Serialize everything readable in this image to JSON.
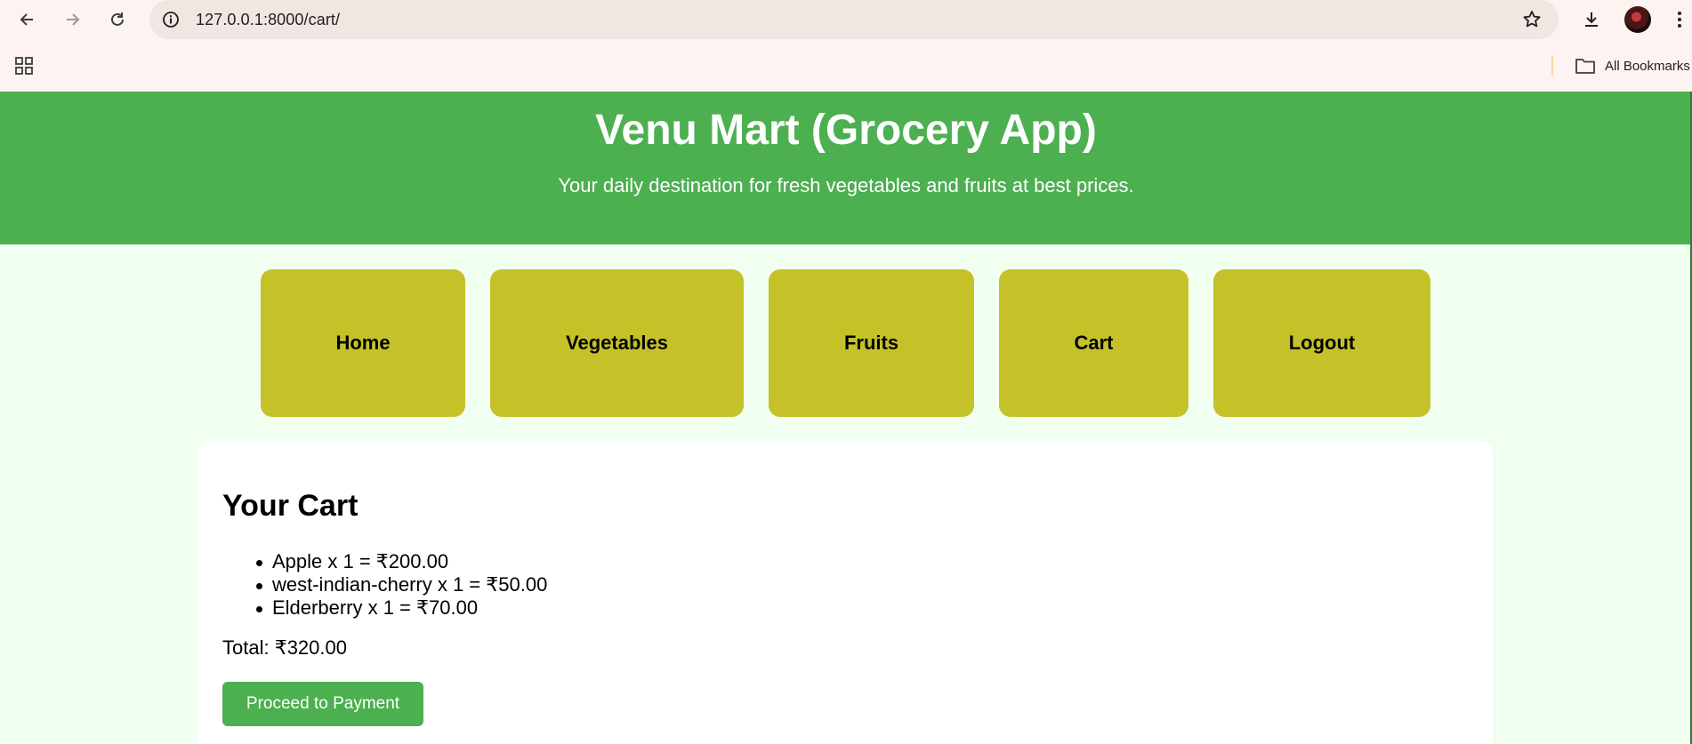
{
  "browser": {
    "url": "127.0.0.1:8000/cart/",
    "bookmarks_label": "All Bookmarks"
  },
  "header": {
    "title": "Venu Mart (Grocery App)",
    "subtitle": "Your daily destination for fresh vegetables and fruits at best prices.",
    "background": "#4caf50"
  },
  "nav": {
    "items": [
      {
        "label": "Home"
      },
      {
        "label": "Vegetables"
      },
      {
        "label": "Fruits"
      },
      {
        "label": "Cart"
      },
      {
        "label": "Logout"
      }
    ],
    "button_color": "#c5c229"
  },
  "cart": {
    "heading": "Your Cart",
    "items": [
      {
        "text": "Apple x 1 = ₹200.00"
      },
      {
        "text": "west-indian-cherry x 1 = ₹50.00"
      },
      {
        "text": "Elderberry x 1 = ₹70.00"
      }
    ],
    "total": "Total: ₹320.00",
    "pay_button": "Proceed to Payment"
  },
  "colors": {
    "page_background": "#f0fff0",
    "accent": "#4caf50"
  }
}
